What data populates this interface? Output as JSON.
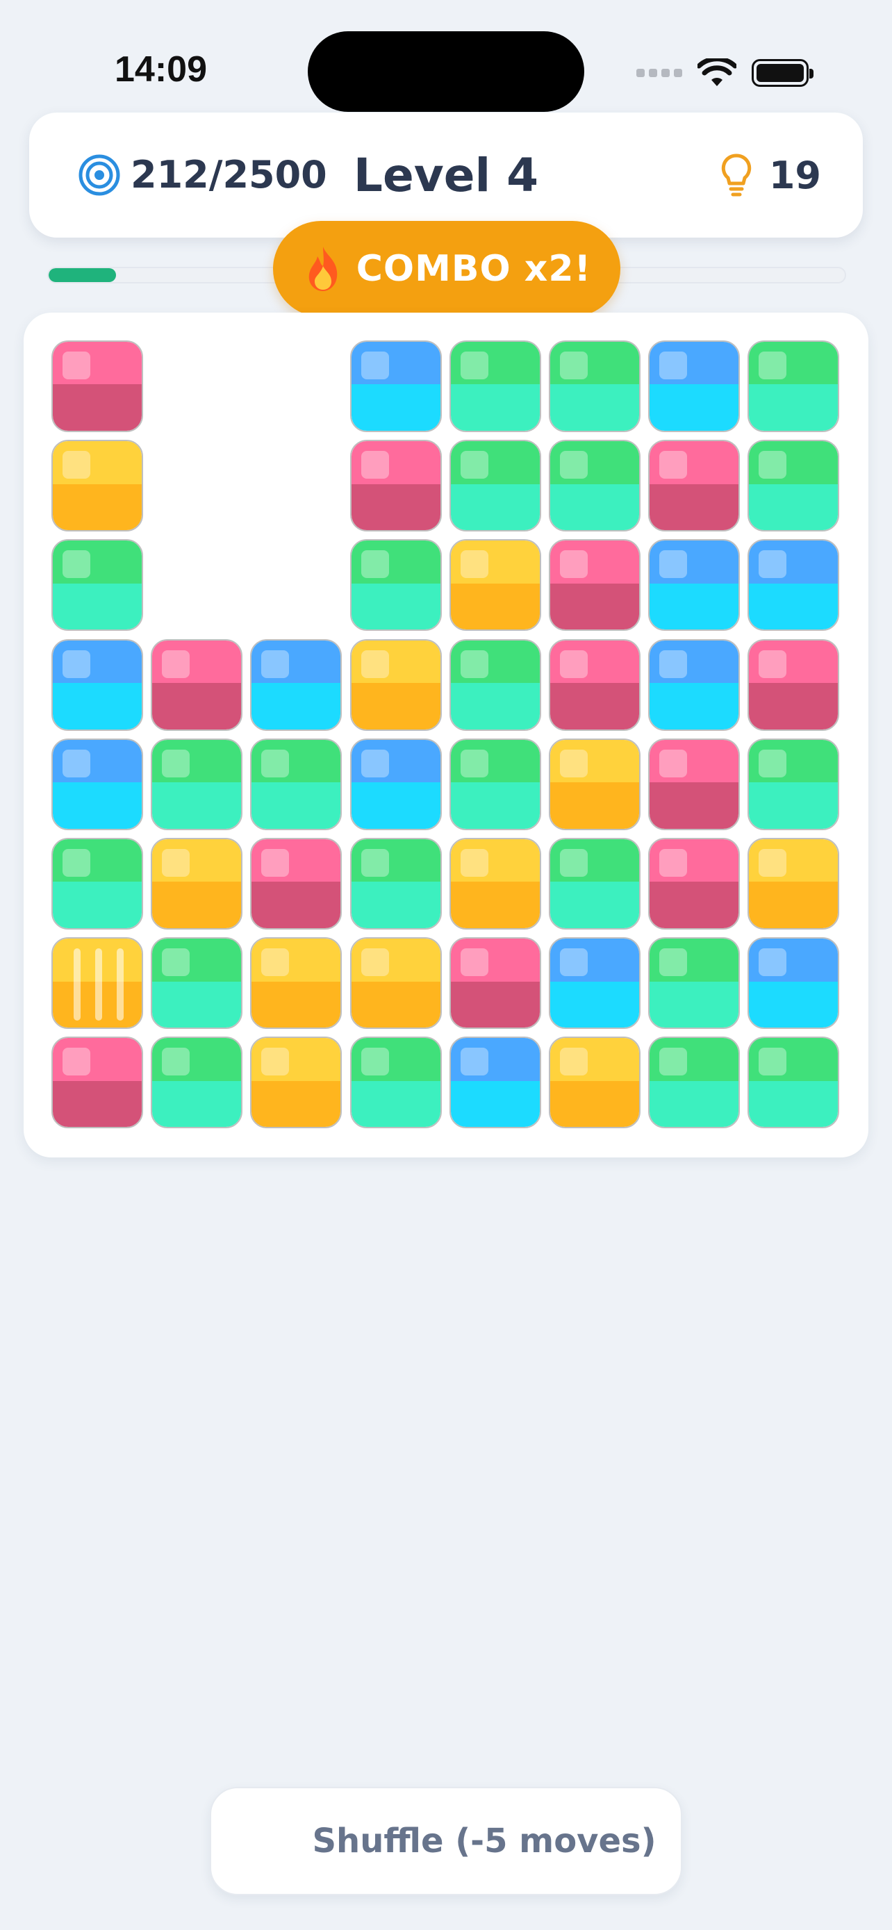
{
  "status_bar": {
    "time": "14:09"
  },
  "header": {
    "score": "212/2500",
    "level_title": "Level 4",
    "hints": "19"
  },
  "progress": {
    "fraction": 0.085
  },
  "combo": {
    "label": "COMBO x2!"
  },
  "colors": {
    "pink": "#d45278",
    "yellow": "#ffb51e",
    "green": "#3cf0bf",
    "blue": "#1cdbff",
    "progress": "#1fb37c",
    "combo": "#f4a010"
  },
  "board": {
    "rows": 8,
    "cols": 8,
    "tiles": [
      [
        "pink",
        "",
        "",
        "blue",
        "green",
        "green",
        "blue",
        "green"
      ],
      [
        "yellow",
        "",
        "",
        "pink",
        "green",
        "green",
        "pink",
        "green"
      ],
      [
        "green",
        "",
        "",
        "green",
        "yellow",
        "pink",
        "blue",
        "blue"
      ],
      [
        "blue",
        "pink",
        "blue",
        "yellow",
        "green",
        "pink",
        "blue",
        "pink"
      ],
      [
        "blue",
        "green",
        "green",
        "blue",
        "green",
        "yellow",
        "pink",
        "green"
      ],
      [
        "green",
        "yellow",
        "pink",
        "green",
        "yellow",
        "green",
        "pink",
        "yellow"
      ],
      [
        "yellow-striped",
        "green",
        "yellow",
        "yellow",
        "pink",
        "blue",
        "green",
        "blue"
      ],
      [
        "pink",
        "green",
        "yellow",
        "green",
        "blue",
        "yellow",
        "green",
        "green"
      ]
    ]
  },
  "shuffle": {
    "label": "Shuffle (-5 moves)"
  }
}
